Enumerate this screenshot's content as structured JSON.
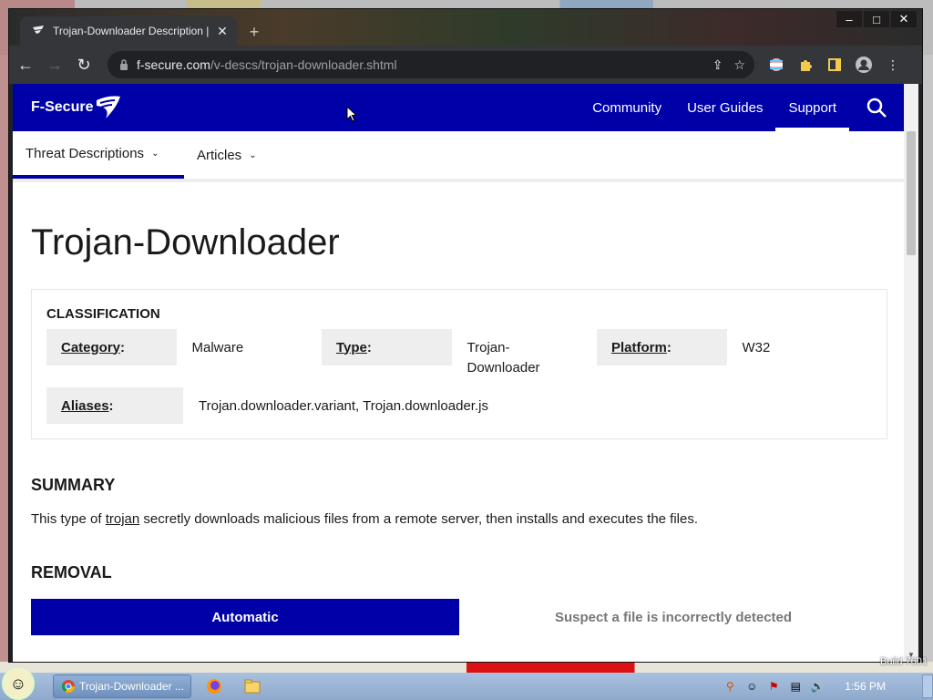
{
  "browser": {
    "tab_title": "Trojan-Downloader Description |",
    "url_host": "f-secure.com",
    "url_path": "/v-descs/trojan-downloader.shtml"
  },
  "site": {
    "logo_text": "F-Secure",
    "nav": [
      "Community",
      "User Guides",
      "Support"
    ],
    "active_nav": "Support",
    "subnav": [
      "Threat Descriptions",
      "Articles"
    ]
  },
  "page": {
    "title": "Trojan-Downloader",
    "classification_heading": "CLASSIFICATION",
    "category_label": "Category",
    "category_value": "Malware",
    "type_label": "Type",
    "type_value_1": "Trojan-",
    "type_value_2": "Downloader",
    "platform_label": "Platform",
    "platform_value": "W32",
    "aliases_label": "Aliases",
    "aliases_value": "Trojan.downloader.variant, Trojan.downloader.js",
    "summary_heading": "SUMMARY",
    "summary_before": "This type of ",
    "summary_link": "trojan",
    "summary_after": " secretly downloads malicious files from a remote server, then installs and executes the files.",
    "removal_heading": "REMOVAL",
    "removal_tab_auto": "Automatic",
    "removal_tab_suspect": "Suspect a file is incorrectly detected"
  },
  "taskbar": {
    "task_label": "Trojan-Downloader ...",
    "clock": "1:56 PM",
    "build": "Build 7601"
  },
  "colors": {
    "brand_blue": "#0000a8",
    "chrome_dark": "#35363a"
  }
}
